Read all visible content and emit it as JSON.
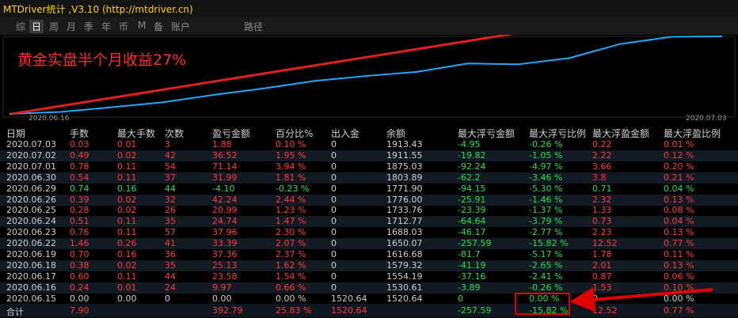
{
  "window": {
    "title": "MTDriver统计 ,V3.10 (http://mtdriver.cn)"
  },
  "tabs": [
    {
      "label": "综"
    },
    {
      "label": "日",
      "active": true
    },
    {
      "label": "周"
    },
    {
      "label": "月"
    },
    {
      "label": "季"
    },
    {
      "label": "年"
    },
    {
      "label": "币"
    },
    {
      "label": "M"
    },
    {
      "label": "备"
    },
    {
      "label": "账户"
    },
    {
      "label": "路径"
    }
  ],
  "chart": {
    "annotation": "黄金实盘半个月收益27%",
    "start_date": "2020.06.16",
    "end_date": "2020.07.03",
    "line_color": "#20a8ff",
    "arrow_color": "#e02020"
  },
  "chart_data": {
    "type": "line",
    "x": [
      "2020.06.15",
      "2020.06.16",
      "2020.06.17",
      "2020.06.18",
      "2020.06.19",
      "2020.06.22",
      "2020.06.23",
      "2020.06.24",
      "2020.06.25",
      "2020.06.26",
      "2020.06.29",
      "2020.06.30",
      "2020.07.01",
      "2020.07.02",
      "2020.07.03"
    ],
    "series": [
      {
        "values": [
          1520.64,
          1530.61,
          1554.19,
          1579.32,
          1616.68,
          1650.07,
          1688.03,
          1712.77,
          1733.76,
          1776.0,
          1771.9,
          1803.89,
          1875.03,
          1911.55,
          1913.43
        ]
      }
    ],
    "xlabel": "",
    "ylabel": ""
  },
  "table": {
    "headers": [
      "日期",
      "手数",
      "最大手数",
      "次数",
      "盈亏金额",
      "百分比%",
      "出入金",
      "余额",
      "最大浮亏金额",
      "最大浮亏比例",
      "最大浮盈金额",
      "最大浮盈比例"
    ],
    "rows": [
      [
        "2020.07.03",
        "0.03",
        "0.01",
        "3",
        "1.88",
        "0.10 %",
        "0",
        "1913.43",
        "-4.95",
        "-0.26 %",
        "0.22",
        "0.01 %"
      ],
      [
        "2020.07.02",
        "0.49",
        "0.02",
        "42",
        "36.52",
        "1.95 %",
        "0",
        "1911.55",
        "-19.82",
        "-1.05 %",
        "2.22",
        "0.12 %"
      ],
      [
        "2020.07.01",
        "0.78",
        "0.11",
        "54",
        "71.14",
        "3.94 %",
        "0",
        "1875.03",
        "-92.24",
        "-4.97 %",
        "3.66",
        "0.20 %"
      ],
      [
        "2020.06.30",
        "0.54",
        "0.11",
        "37",
        "31.99",
        "1.81 %",
        "0",
        "1803.89",
        "-62.2",
        "-3.46 %",
        "3.8",
        "0.21 %"
      ],
      [
        "2020.06.29",
        "0.74",
        "0.16",
        "44",
        "-4.10",
        "-0.23 %",
        "0",
        "1771.90",
        "-94.15",
        "-5.30 %",
        "0.71",
        "0.04 %"
      ],
      [
        "2020.06.26",
        "0.39",
        "0.02",
        "32",
        "42.24",
        "2.44 %",
        "0",
        "1776.00",
        "-25.91",
        "-1.46 %",
        "2.32",
        "0.13 %"
      ],
      [
        "2020.06.25",
        "0.28",
        "0.02",
        "26",
        "20.99",
        "1.23 %",
        "0",
        "1733.76",
        "-23.39",
        "-1.37 %",
        "1.33",
        "0.08 %"
      ],
      [
        "2020.06.24",
        "0.51",
        "0.11",
        "35",
        "24.74",
        "1.47 %",
        "0",
        "1712.77",
        "-64.64",
        "-3.79 %",
        "0.73",
        "0.04 %"
      ],
      [
        "2020.06.23",
        "0.76",
        "0.11",
        "57",
        "37.96",
        "2.30 %",
        "0",
        "1688.03",
        "-46.17",
        "-2.77 %",
        "2.23",
        "0.13 %"
      ],
      [
        "2020.06.22",
        "1.46",
        "0.26",
        "41",
        "33.39",
        "2.07 %",
        "0",
        "1650.07",
        "-257.59",
        "-15.82 %",
        "12.52",
        "0.77 %"
      ],
      [
        "2020.06.19",
        "0.70",
        "0.16",
        "36",
        "37.36",
        "2.37 %",
        "0",
        "1616.68",
        "-81.7",
        "-5.17 %",
        "1.78",
        "0.11 %"
      ],
      [
        "2020.06.18",
        "0.38",
        "0.02",
        "35",
        "25.13",
        "1.62 %",
        "0",
        "1579.32",
        "-41.19",
        "-2.65 %",
        "2.01",
        "0.13 %"
      ],
      [
        "2020.06.17",
        "0.60",
        "0.11",
        "44",
        "23.58",
        "1.54 %",
        "0",
        "1554.19",
        "-37.16",
        "-2.41 %",
        "0.87",
        "0.06 %"
      ],
      [
        "2020.06.16",
        "0.24",
        "0.01",
        "24",
        "9.97",
        "0.66 %",
        "0",
        "1530.61",
        "-3.89",
        "-0.26 %",
        "1.53",
        "0.10 %"
      ],
      [
        "2020.06.15",
        "0.00",
        "0.00",
        "0",
        "0.00",
        "0.00 %",
        "1520.64",
        "1520.64",
        "0",
        "0.00 %",
        "0",
        "0.00 %"
      ]
    ],
    "total": [
      "合计",
      "7.90",
      "",
      "",
      "392.79",
      "25.83 %",
      "1520.64",
      "",
      "-257.59",
      "-15.82 %",
      "12.52",
      "0.77 %"
    ]
  }
}
